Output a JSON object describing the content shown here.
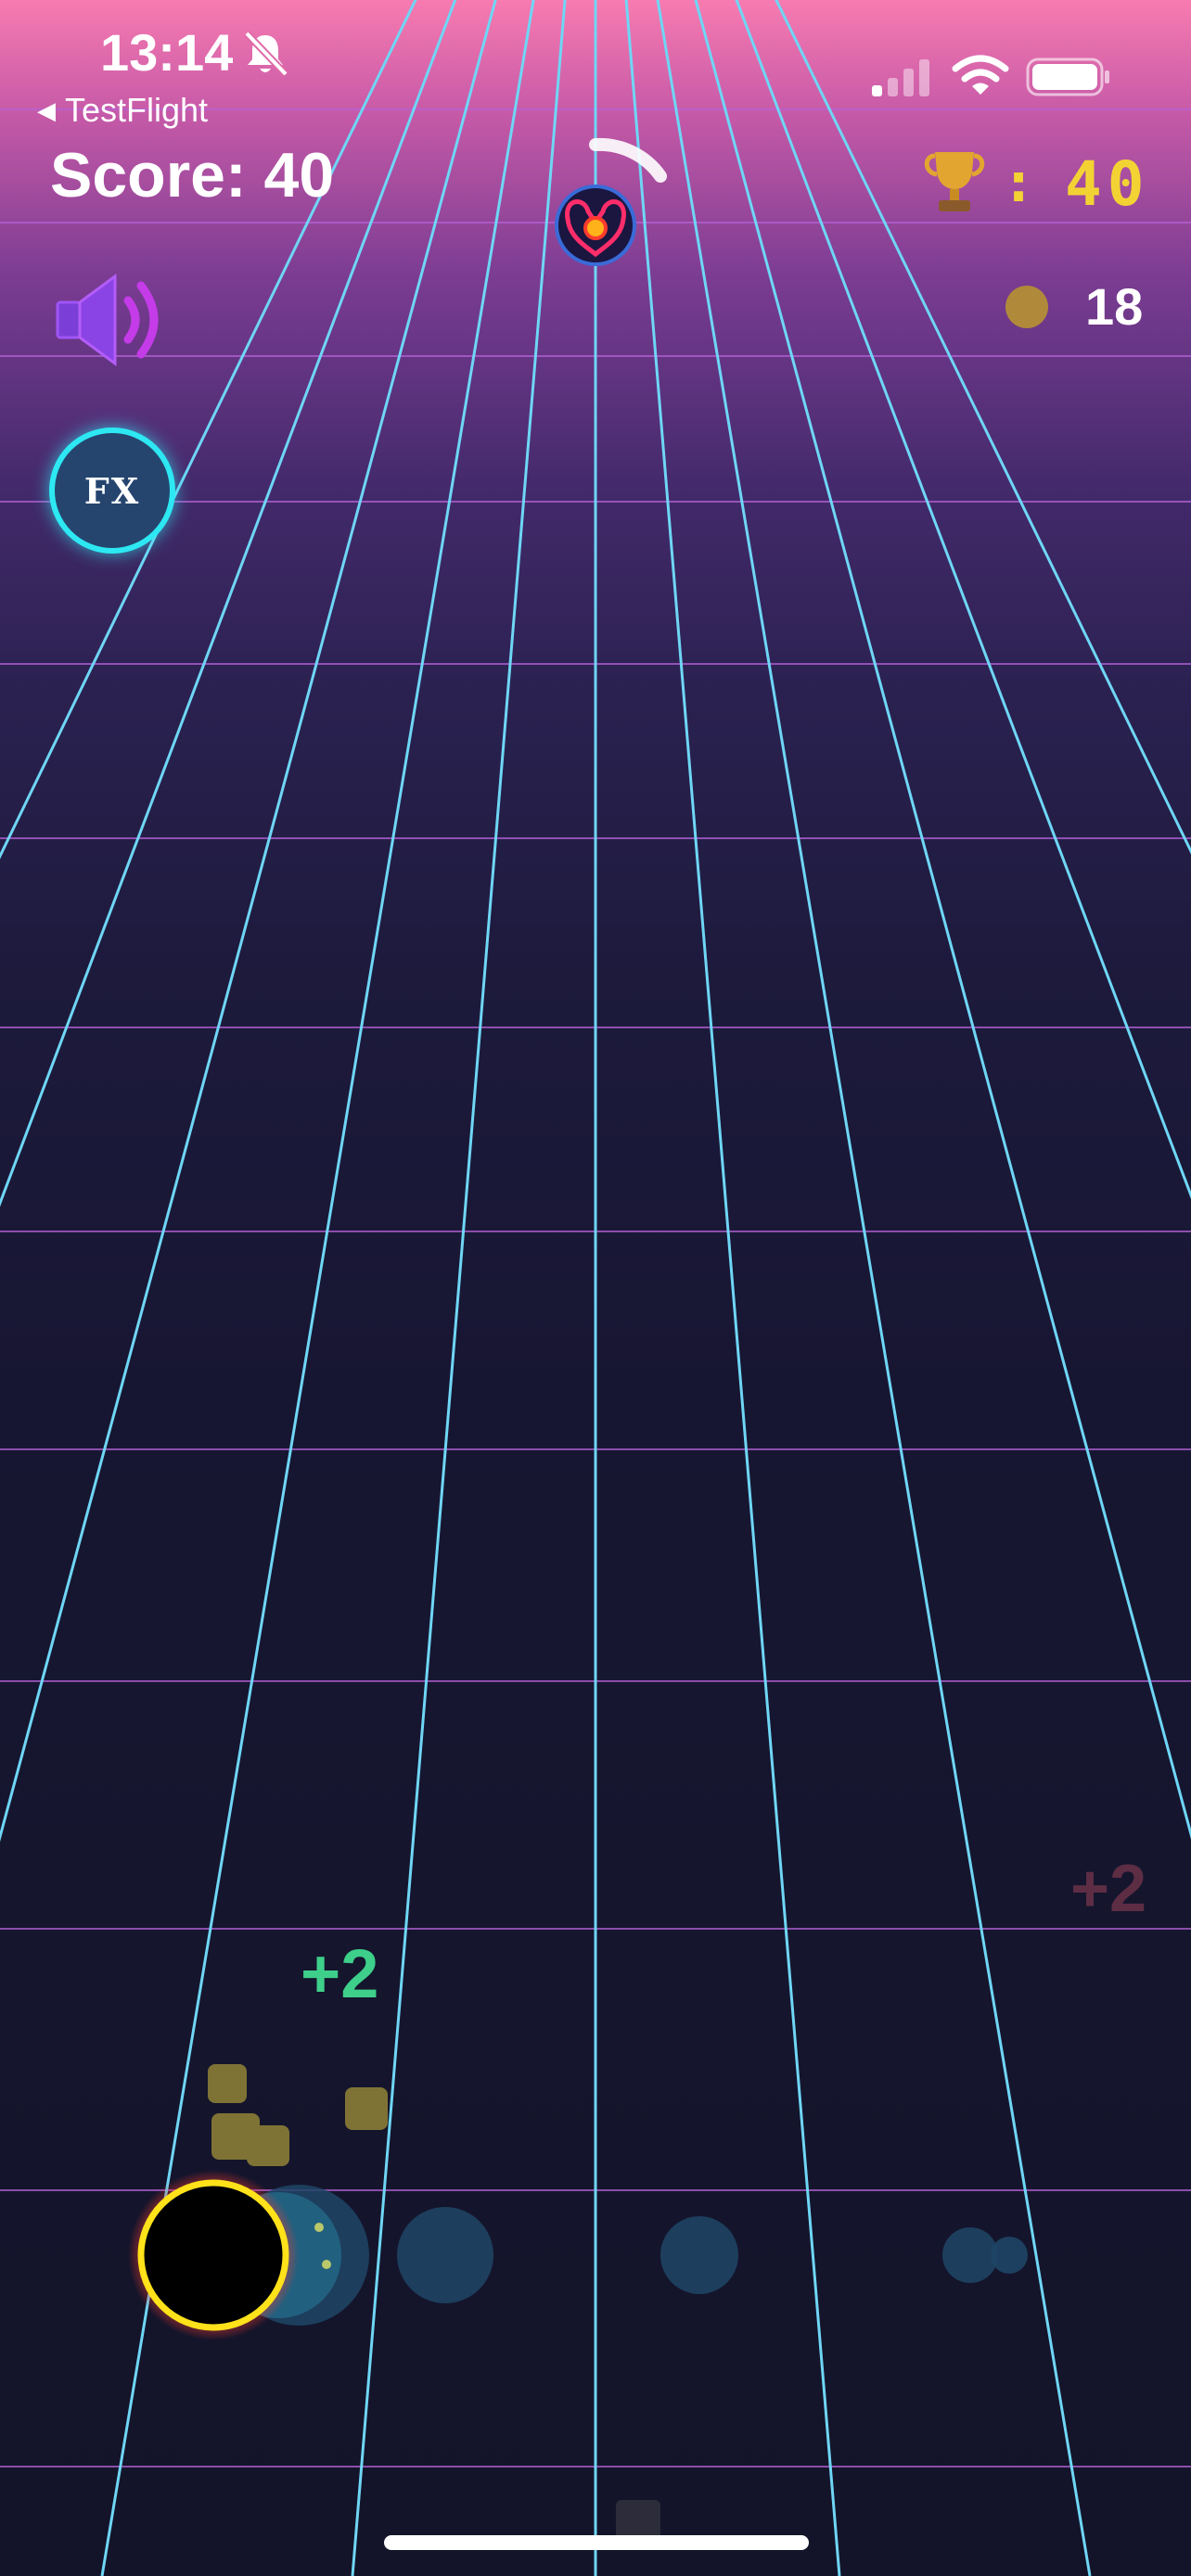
{
  "status_bar": {
    "time": "13:14",
    "back_app": "TestFlight",
    "icons": [
      "bell-slash-icon",
      "signal-icon",
      "wifi-icon",
      "battery-icon"
    ]
  },
  "hud": {
    "score_text": "Score: 40",
    "best_score_colon": ":",
    "best_score": "40",
    "coins": "18",
    "fx_label": "FX",
    "colors": {
      "best_score": "#f3d334",
      "fx_ring": "#2de8f2",
      "sound": "#9b3ff0"
    }
  },
  "floating_texts": {
    "green": "+2",
    "faded": "+2"
  },
  "colors": {
    "lane_lines": "#6fd6f5",
    "grid_lines": "#b462d6",
    "player_ring": "#ffe21a",
    "player_glow": "#ff3b2e"
  }
}
